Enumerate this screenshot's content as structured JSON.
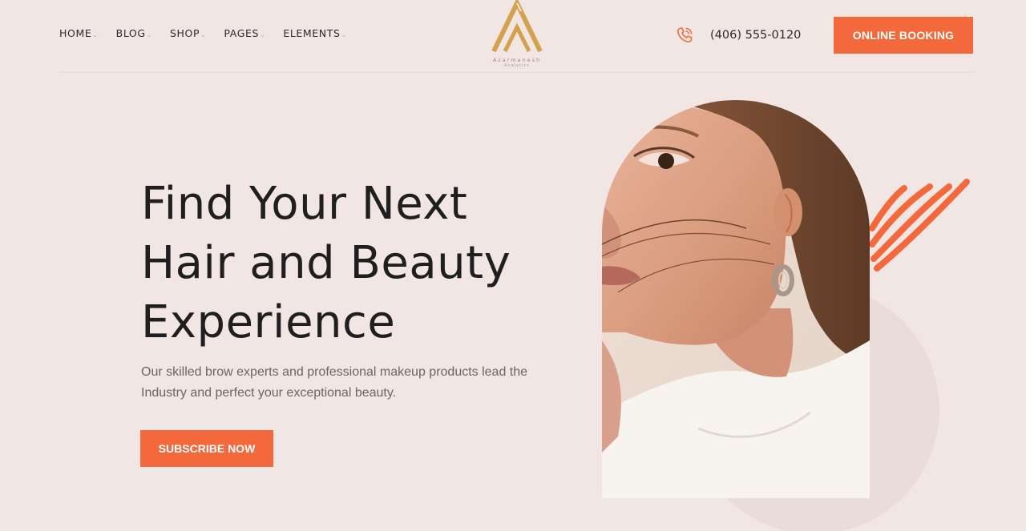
{
  "nav": {
    "items": [
      {
        "label": "HOME"
      },
      {
        "label": "BLOG"
      },
      {
        "label": "SHOP"
      },
      {
        "label": "PAGES"
      },
      {
        "label": "ELEMENTS"
      }
    ]
  },
  "logo": {
    "brand": "Azarmanesh",
    "tagline": "Analytics"
  },
  "contact": {
    "phone": "(406) 555-0120",
    "icon": "phone-icon"
  },
  "header": {
    "booking_label": "ONLINE BOOKING"
  },
  "hero": {
    "headline_lines": [
      "Find Your Next",
      "Hair and Beauty",
      "Experience"
    ],
    "description_lines": [
      "Our skilled brow experts and professional makeup products lead the",
      "Industry and perfect your exceptional beauty."
    ],
    "cta_label": "SUBSCRIBE NOW"
  },
  "colors": {
    "accent": "#f4693b",
    "background": "#f1e6e3",
    "logo_gold": "#d4a24c"
  }
}
